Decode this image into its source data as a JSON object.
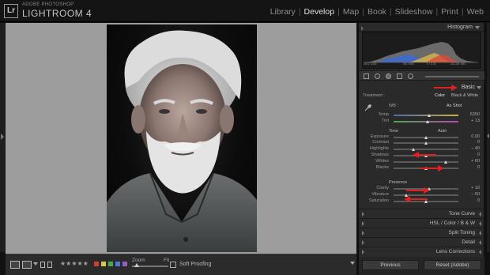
{
  "app": {
    "brand_sub": "ADOBE PHOTOSHOP",
    "brand_main": "LIGHTROOM 4",
    "logo": "Lr"
  },
  "modules": [
    {
      "label": "Library",
      "active": false
    },
    {
      "label": "Develop",
      "active": true
    },
    {
      "label": "Map",
      "active": false
    },
    {
      "label": "Book",
      "active": false
    },
    {
      "label": "Slideshow",
      "active": false
    },
    {
      "label": "Print",
      "active": false
    },
    {
      "label": "Web",
      "active": false
    }
  ],
  "histogram": {
    "title": "Histogram",
    "iso": "ISO 100",
    "focal": "50 mm",
    "aperture": "f / 2.8",
    "shutter": "1/125 sec"
  },
  "basic": {
    "title": "Basic",
    "treatment_label": "Treatment :",
    "treatment_color": "Color",
    "treatment_bw": "Black & White",
    "wb_label": "WB :",
    "wb_value": "As Shot",
    "tone_label": "Tone",
    "tone_auto": "Auto",
    "presence_label": "Presence"
  },
  "sliders": [
    {
      "label": "Temp",
      "value": "6350",
      "group": "wb",
      "pos": 0.55
    },
    {
      "label": "Tint",
      "value": "+ 13",
      "group": "wb",
      "pos": 0.53
    },
    {
      "label": "Exposure",
      "value": "0.00",
      "group": "tone",
      "pos": 0.5
    },
    {
      "label": "Contrast",
      "value": "0",
      "group": "tone",
      "pos": 0.5
    },
    {
      "label": "Highlights",
      "value": "− 40",
      "group": "tone",
      "pos": 0.3
    },
    {
      "label": "Shadows",
      "value": "0",
      "group": "tone",
      "pos": 0.5
    },
    {
      "label": "Whites",
      "value": "+ 60",
      "group": "tone",
      "pos": 0.8
    },
    {
      "label": "Blacks",
      "value": "0",
      "group": "tone",
      "pos": 0.5
    },
    {
      "label": "Clarity",
      "value": "+ 10",
      "group": "presence",
      "pos": 0.55
    },
    {
      "label": "Vibrance",
      "value": "− 60",
      "group": "presence",
      "pos": 0.2
    },
    {
      "label": "Saturation",
      "value": "0",
      "group": "presence",
      "pos": 0.5
    }
  ],
  "collapsed_panels": [
    "Tone Curve",
    "HSL  /  Color  /  B & W",
    "Split Toning",
    "Detail",
    "Lens Corrections"
  ],
  "buttons": {
    "previous": "Previous",
    "reset": "Reset (Adobe)"
  },
  "toolbar": {
    "zoom_label": "Zoom",
    "zoom_value": "Fit",
    "soft_proofing": "Soft Proofing",
    "stars": "★★★★★"
  },
  "color_labels": [
    "#d23b3b",
    "#d8c84a",
    "#4ca84c",
    "#4a7ad8",
    "#9a5ac8"
  ],
  "accent": "#e02020"
}
